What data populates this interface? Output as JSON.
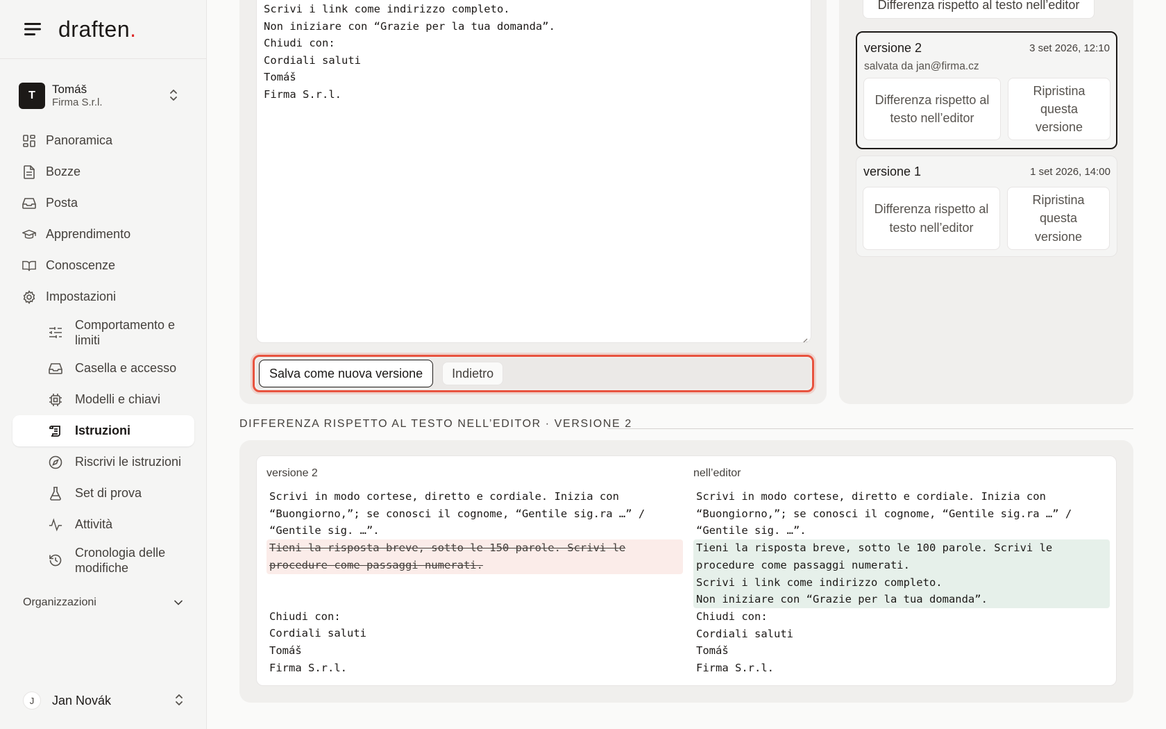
{
  "brand": {
    "name": "draften",
    "dot": "."
  },
  "org_switch": {
    "initial": "T",
    "name": "Tomáš",
    "company": "Firma S.r.l."
  },
  "nav": {
    "panoramica": "Panoramica",
    "bozze": "Bozze",
    "posta": "Posta",
    "apprendimento": "Apprendimento",
    "conoscenze": "Conoscenze",
    "impostazioni": "Impostazioni",
    "sub": {
      "comportamento": "Comportamento e limiti",
      "casella": "Casella e accesso",
      "modelli": "Modelli e chiavi",
      "istruzioni": "Istruzioni",
      "riscrivi": "Riscrivi le istruzioni",
      "set_prova": "Set di prova",
      "attivita": "Attività",
      "cronologia": "Cronologia delle modifiche"
    },
    "organizzazioni": "Organizzazioni"
  },
  "user": {
    "initial": "J",
    "name": "Jan Novák"
  },
  "editor": {
    "lines": [
      "Scrivi i link come indirizzo completo.",
      "Non iniziare con “Grazie per la tua domanda”.",
      "Chiudi con:",
      "Cordiali saluti",
      "Tomáš",
      "Firma S.r.l."
    ],
    "save_label": "Salva come nuova versione",
    "back_label": "Indietro"
  },
  "versions": {
    "prev_diff_label": "Differenza rispetto al testo nell’editor",
    "items": [
      {
        "title": "versione 2",
        "date": "3 set 2026, 12:10",
        "saved_by": "salvata da jan@firma.cz",
        "diff_label": "Differenza rispetto al testo nell’editor",
        "restore_label": "Ripristina questa versione",
        "selected": true
      },
      {
        "title": "versione 1",
        "date": "1 set 2026, 14:00",
        "saved_by": "",
        "diff_label": "Differenza rispetto al testo nell’editor",
        "restore_label": "Ripristina questa versione",
        "selected": false
      }
    ]
  },
  "diff": {
    "heading": "DIFFERENZA RISPETTO AL TESTO NELL’EDITOR · VERSIONE 2",
    "left_title": "versione 2",
    "right_title": "nell’editor",
    "common_head": [
      "Scrivi in modo cortese, diretto e cordiale. Inizia con",
      "“Buongiorno,”; se conosci il cognome, “Gentile sig.ra …” /",
      "“Gentile sig. …”."
    ],
    "removed": [
      "Tieni la risposta breve, sotto le 150 parole. Scrivi le",
      "procedure come passaggi numerati."
    ],
    "added": [
      "Tieni la risposta breve, sotto le 100 parole. Scrivi le",
      "procedure come passaggi numerati.",
      "Scrivi i link come indirizzo completo.",
      "Non iniziare con “Grazie per la tua domanda”."
    ],
    "common_tail": [
      "Chiudi con:",
      "Cordiali saluti",
      "Tomáš",
      "Firma S.r.l."
    ]
  },
  "colors": {
    "accent_outline": "#e8533f",
    "removed_bg": "#fbece9",
    "added_bg": "#e6f0ea",
    "brand_dot": "#dc2626"
  }
}
